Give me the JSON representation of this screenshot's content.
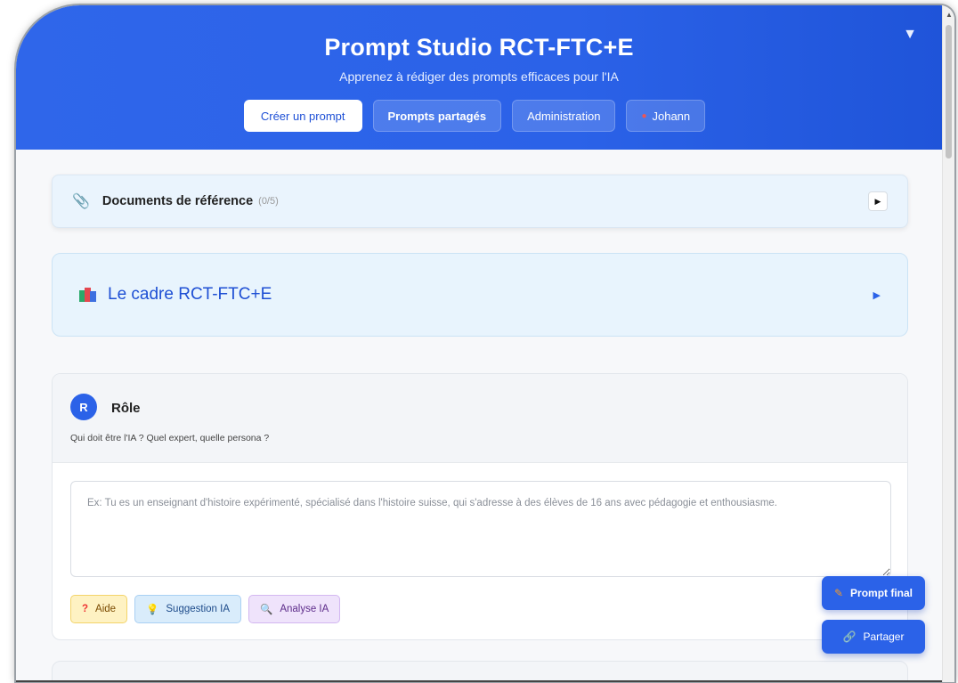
{
  "header": {
    "title": "Prompt Studio RCT-FTC+E",
    "subtitle": "Apprenez à rédiger des prompts efficaces pour l'IA",
    "collapse_icon": "▼",
    "nav": [
      {
        "label": "Créer un prompt",
        "active": true
      },
      {
        "label": "Prompts partagés"
      },
      {
        "label": "Administration"
      },
      {
        "label": "Johann",
        "icon": "user-icon"
      }
    ]
  },
  "documents": {
    "icon": "paperclip-icon",
    "title": "Documents de référence",
    "count": "(0/5)",
    "toggle": "▶"
  },
  "framework": {
    "icon": "books-icon",
    "title": "Le cadre RCT-FTC+E",
    "toggle": "▶"
  },
  "role": {
    "badge": "R",
    "title": "Rôle",
    "description": "Qui doit être l'IA ? Quel expert, quelle persona ?",
    "placeholder": "Ex: Tu es un enseignant d'histoire expérimenté, spécialisé dans l'histoire suisse, qui s'adresse à des élèves de 16 ans avec pédagogie et enthousiasme.",
    "value": "",
    "buttons": {
      "help": {
        "icon": "?",
        "label": "Aide"
      },
      "suggestion": {
        "icon": "💡",
        "label": "Suggestion IA"
      },
      "analysis": {
        "icon": "🔍",
        "label": "Analyse IA"
      }
    }
  },
  "floating": {
    "final": {
      "icon": "✎",
      "label": "Prompt final"
    },
    "share": {
      "icon": "🔗",
      "label": "Partager"
    }
  },
  "colors": {
    "header_blue": "#2b62e8",
    "accent": "#1e50d6",
    "panel_bg": "#e8f4fd"
  }
}
